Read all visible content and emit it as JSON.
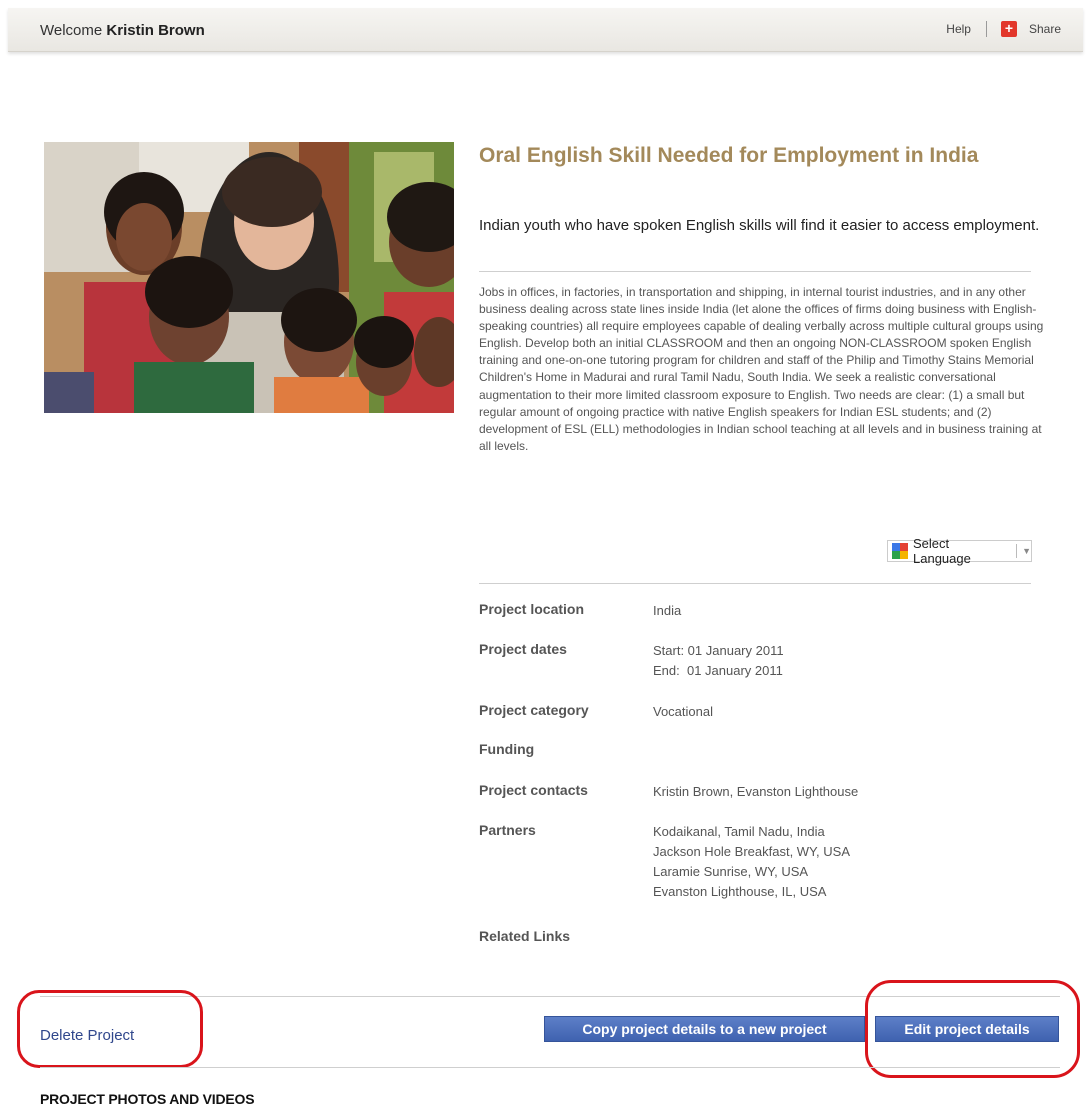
{
  "header": {
    "welcome_prefix": "Welcome",
    "user_name": "Kristin Brown",
    "help_label": "Help",
    "share_icon_glyph": "+",
    "share_label": "Share"
  },
  "project": {
    "title": "Oral English Skill Needed for Employment in India",
    "subtitle": "Indian youth who have spoken English skills will find it easier to access employment.",
    "description": "Jobs in offices, in factories, in transportation and shipping, in internal tourist industries, and in any other business dealing across state lines inside India (let alone the offices of firms doing business with English-speaking countries) all require employees capable of dealing verbally across multiple cultural groups using English. Develop both an initial CLASSROOM and then an ongoing NON-CLASSROOM spoken English training and one-on-one tutoring program for children and staff of the Philip and Timothy Stains Memorial Children's Home in Madurai and rural Tamil Nadu, South India. We seek a realistic conversational augmentation to their more limited classroom exposure to English. Two needs are clear: (1) a small but regular amount of ongoing practice with native English speakers for Indian ESL students; and (2) development of ESL (ELL) methodologies in Indian school teaching at all levels and in business training at all levels."
  },
  "language_select": {
    "label": "Select Language",
    "caret": "▼"
  },
  "details": {
    "location_label": "Project location",
    "location_value": "India",
    "dates_label": "Project dates",
    "dates_start": "Start: 01 January 2011",
    "dates_end": "End:  01 January 2011",
    "category_label": "Project category",
    "category_value": "Vocational",
    "funding_label": "Funding",
    "contacts_label": "Project contacts",
    "contacts_value": "Kristin Brown, Evanston Lighthouse",
    "partners_label": "Partners",
    "partners": [
      "Kodaikanal, Tamil Nadu, India",
      "Jackson Hole Breakfast, WY, USA",
      "Laramie Sunrise, WY, USA",
      "Evanston Lighthouse, IL, USA"
    ],
    "related_links_label": "Related Links"
  },
  "actions": {
    "delete_label": "Delete Project",
    "copy_label": "Copy project details to a new project",
    "edit_label": "Edit project details"
  },
  "sections": {
    "photos_heading": "PROJECT PHOTOS AND VIDEOS"
  },
  "colors": {
    "title": "#a3895a",
    "button": "#4a6cba",
    "link": "#30478c",
    "annotation": "#d9141b"
  },
  "icons": {
    "share": "share-icon",
    "translate": "google-translate-icon",
    "dropdown": "chevron-down-icon"
  }
}
